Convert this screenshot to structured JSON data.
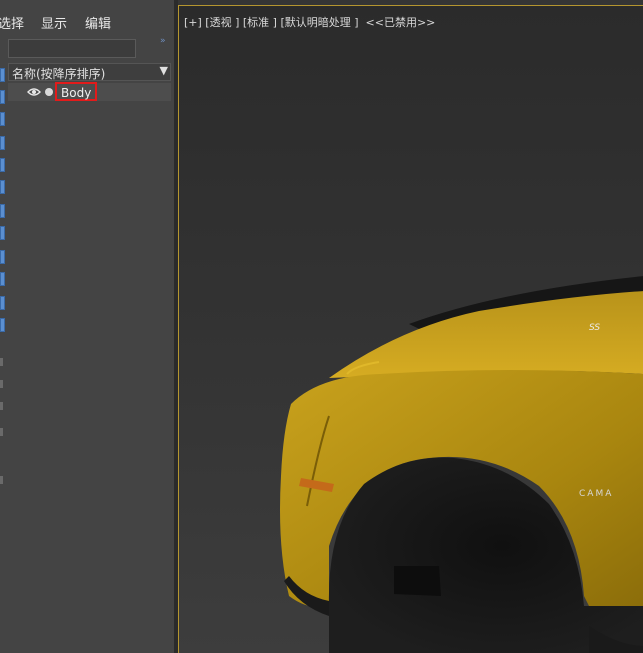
{
  "menu": {
    "select": "选择",
    "display": "显示",
    "edit": "编辑"
  },
  "explorer": {
    "expand_arrows": "»",
    "column_header": "名称(按降序排序)",
    "sort_arrow": "▼",
    "rows": [
      {
        "name": "Body",
        "visible": true,
        "highlighted": true
      }
    ]
  },
  "viewport": {
    "label": "[+] [透视 ] [标准 ] [默认明暗处理 ]  <<已禁用>>",
    "car_color": "#c9a21d",
    "border_color": "#b5962f"
  },
  "icons": {
    "eye": "eye-icon",
    "bulb": "light-bulb-icon",
    "sort": "sort-down-icon"
  }
}
